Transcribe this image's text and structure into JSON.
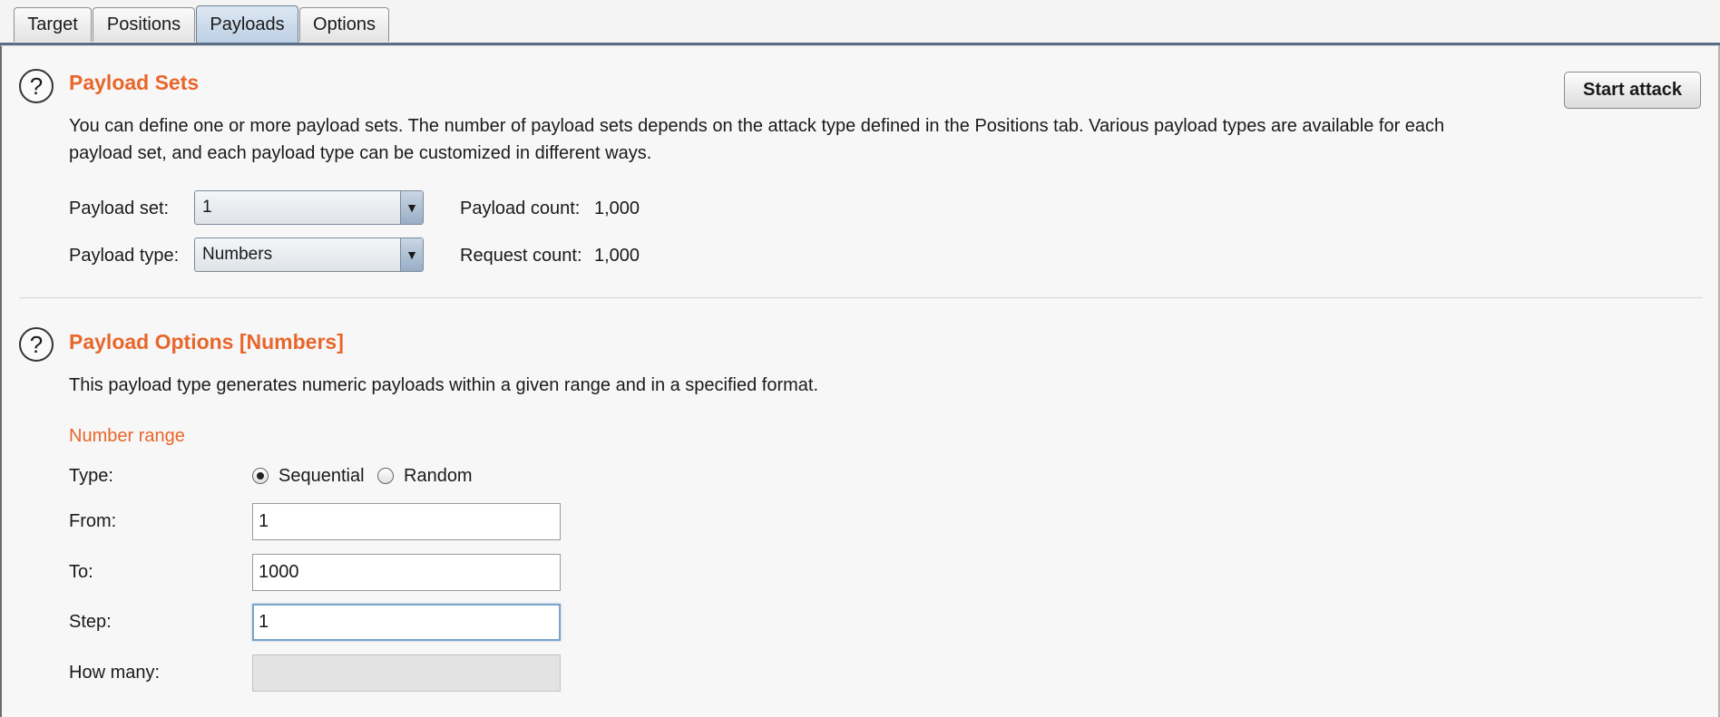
{
  "tabs": [
    {
      "label": "Target"
    },
    {
      "label": "Positions"
    },
    {
      "label": "Payloads",
      "active": true
    },
    {
      "label": "Options"
    }
  ],
  "payload_sets": {
    "title": "Payload Sets",
    "description_line1": "You can define one or more payload sets. The number of payload sets depends on the attack type defined in the Positions tab. Various payload types are available for each",
    "description_line2": "payload set, and each payload type can be customized in different ways.",
    "payload_set_label": "Payload set:",
    "payload_set_value": "1",
    "payload_type_label": "Payload type:",
    "payload_type_value": "Numbers",
    "payload_count_label": "Payload count:",
    "payload_count_value": "1,000",
    "request_count_label": "Request count:",
    "request_count_value": "1,000",
    "start_attack_label": "Start attack"
  },
  "payload_options": {
    "title": "Payload Options [Numbers]",
    "description": "This payload type generates numeric payloads within a given range and in a specified format.",
    "number_range_label": "Number range",
    "type_label": "Type:",
    "sequential_label": "Sequential",
    "random_label": "Random",
    "type_selected": "Sequential",
    "from_label": "From:",
    "from_value": "1",
    "to_label": "To:",
    "to_value": "1000",
    "step_label": "Step:",
    "step_value": "1",
    "how_many_label": "How many:",
    "how_many_value": ""
  },
  "icons": {
    "help": "?",
    "dropdown": "▼"
  },
  "colors": {
    "section_title": "#e8662b",
    "active_tab": "#c6d7e8"
  }
}
